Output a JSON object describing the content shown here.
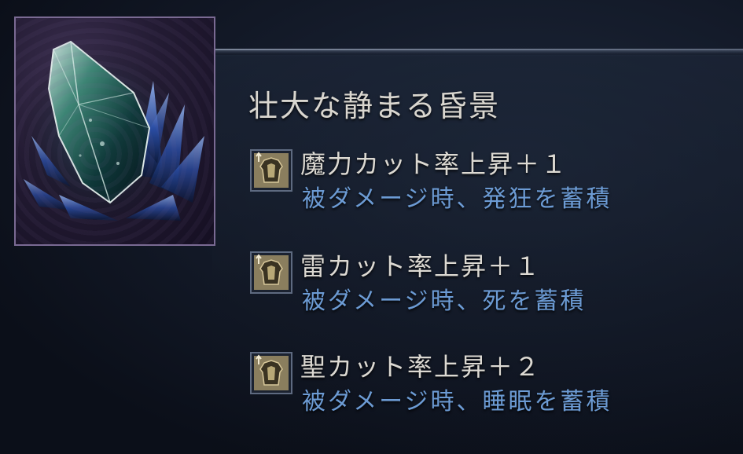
{
  "item": {
    "name": "壮大な静まる昏景",
    "icon": "crystal-shard-icon"
  },
  "effects": [
    {
      "icon": "armor-up-icon",
      "main": "魔力カット率上昇＋１",
      "sub": "被ダメージ時、発狂を蓄積"
    },
    {
      "icon": "armor-up-icon",
      "main": "雷カット率上昇＋１",
      "sub": "被ダメージ時、死を蓄積"
    },
    {
      "icon": "armor-up-icon",
      "main": "聖カット率上昇＋２",
      "sub": "被ダメージ時、睡眠を蓄積"
    }
  ],
  "colors": {
    "title": "#d9d6cf",
    "effect_main": "#dcd9d2",
    "effect_sub": "#6c9bd4",
    "frame_border": "#7a6a93"
  }
}
